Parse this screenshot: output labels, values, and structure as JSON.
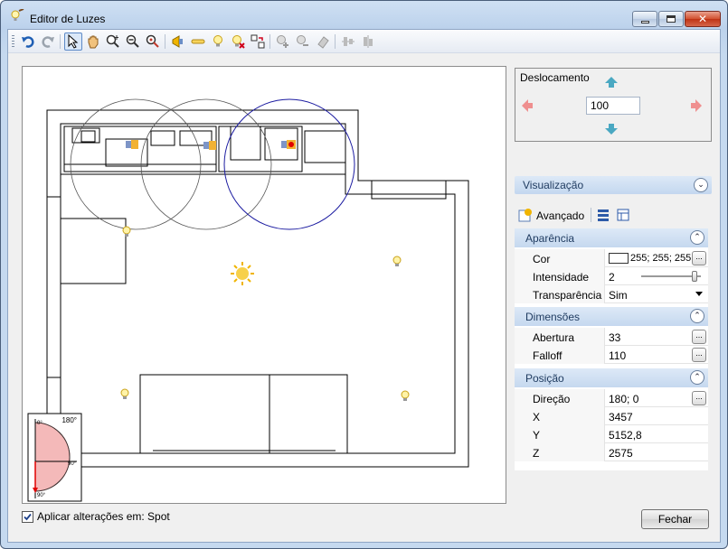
{
  "window": {
    "title": "Editor de Luzes"
  },
  "deslocamento": {
    "label": "Deslocamento",
    "value": "100"
  },
  "sections": {
    "visualizacao": "Visualização",
    "avancado": "Avançado"
  },
  "properties": {
    "aparencia": {
      "label": "Aparência",
      "rows": [
        {
          "name": "Cor",
          "value": "255; 255; 255"
        },
        {
          "name": "Intensidade",
          "value": "2",
          "slider_fraction": 0.9
        },
        {
          "name": "Transparência",
          "value": "Sim"
        }
      ]
    },
    "dimensoes": {
      "label": "Dimensões",
      "rows": [
        {
          "name": "Abertura",
          "value": "33"
        },
        {
          "name": "Falloff",
          "value": "110"
        }
      ]
    },
    "posicao": {
      "label": "Posição",
      "rows": [
        {
          "name": "Direção",
          "value": "180; 0"
        },
        {
          "name": "X",
          "value": "3457"
        },
        {
          "name": "Y",
          "value": "5152,8"
        },
        {
          "name": "Z",
          "value": "2575"
        }
      ]
    }
  },
  "compass": {
    "top_right": "180°",
    "top_left": "0°",
    "right": "90°",
    "bottom": "90°"
  },
  "footer": {
    "apply_label": "Aplicar alterações em: Spot",
    "apply_checked": true,
    "close_button": "Fechar"
  },
  "colors": {
    "accent": "#c5d8ef",
    "selected_circle": "#1a1aa0",
    "cone_fill": "#f4b9b9"
  }
}
